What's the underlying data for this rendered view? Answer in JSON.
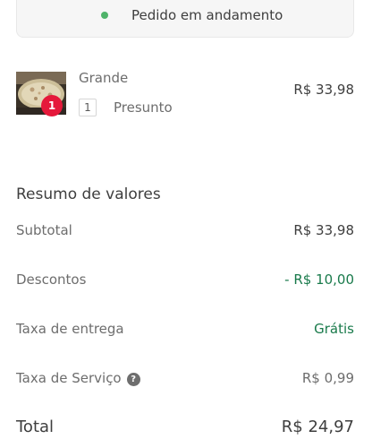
{
  "status": {
    "text": "Pedido em andamento",
    "dot_color": "#4fb36a"
  },
  "item": {
    "thumbnail": "pizza-image",
    "badge_count": "1",
    "badge_color": "#e5193b",
    "name": "Grande",
    "option_qty": "1",
    "option_name": "Presunto",
    "price": "R$ 33,98"
  },
  "summary": {
    "title": "Resumo de valores",
    "subtotal_label": "Subtotal",
    "subtotal_value": "R$ 33,98",
    "discount_label": "Descontos",
    "discount_value": "- R$ 10,00",
    "delivery_label": "Taxa de entrega",
    "delivery_value": "Grátis",
    "service_label": "Taxa de Serviço",
    "service_value": "R$ 0,99",
    "total_label": "Total",
    "total_value": "R$ 24,97",
    "positive_color": "#197a4b",
    "muted_value_color": "#6d6d6d"
  }
}
